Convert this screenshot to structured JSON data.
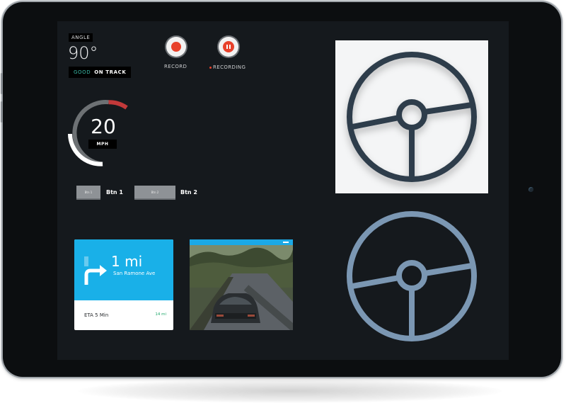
{
  "angle": {
    "label": "ANGLE",
    "value": "90°",
    "status_good": "GOOD",
    "status_text": "ON TRACK"
  },
  "record": {
    "record_label": "RECORD",
    "recording_label": "RECORDING"
  },
  "speed": {
    "value": "20",
    "unit": "MPH"
  },
  "buttons": {
    "btn1_caption": "Btn 1",
    "btn1_label": "Btn 1",
    "btn2_caption": "Btn 2",
    "btn2_label": "Btn 2"
  },
  "navigation": {
    "distance": "1 mi",
    "street": "San Ramone Ave",
    "eta": "ETA 5 Min",
    "eta_distance": "14 mi"
  },
  "icons": {
    "record": "record-icon",
    "pause": "pause-icon",
    "turn": "turn-right-arrow-icon",
    "wheel": "steering-wheel-icon"
  },
  "colors": {
    "accent_red": "#e8412b",
    "nav_blue": "#19b0e8",
    "good_teal": "#39b9a6",
    "wheel_dark": "#2f3e4b",
    "wheel_light": "#7b97b3",
    "eta_green": "#1ea86a"
  }
}
